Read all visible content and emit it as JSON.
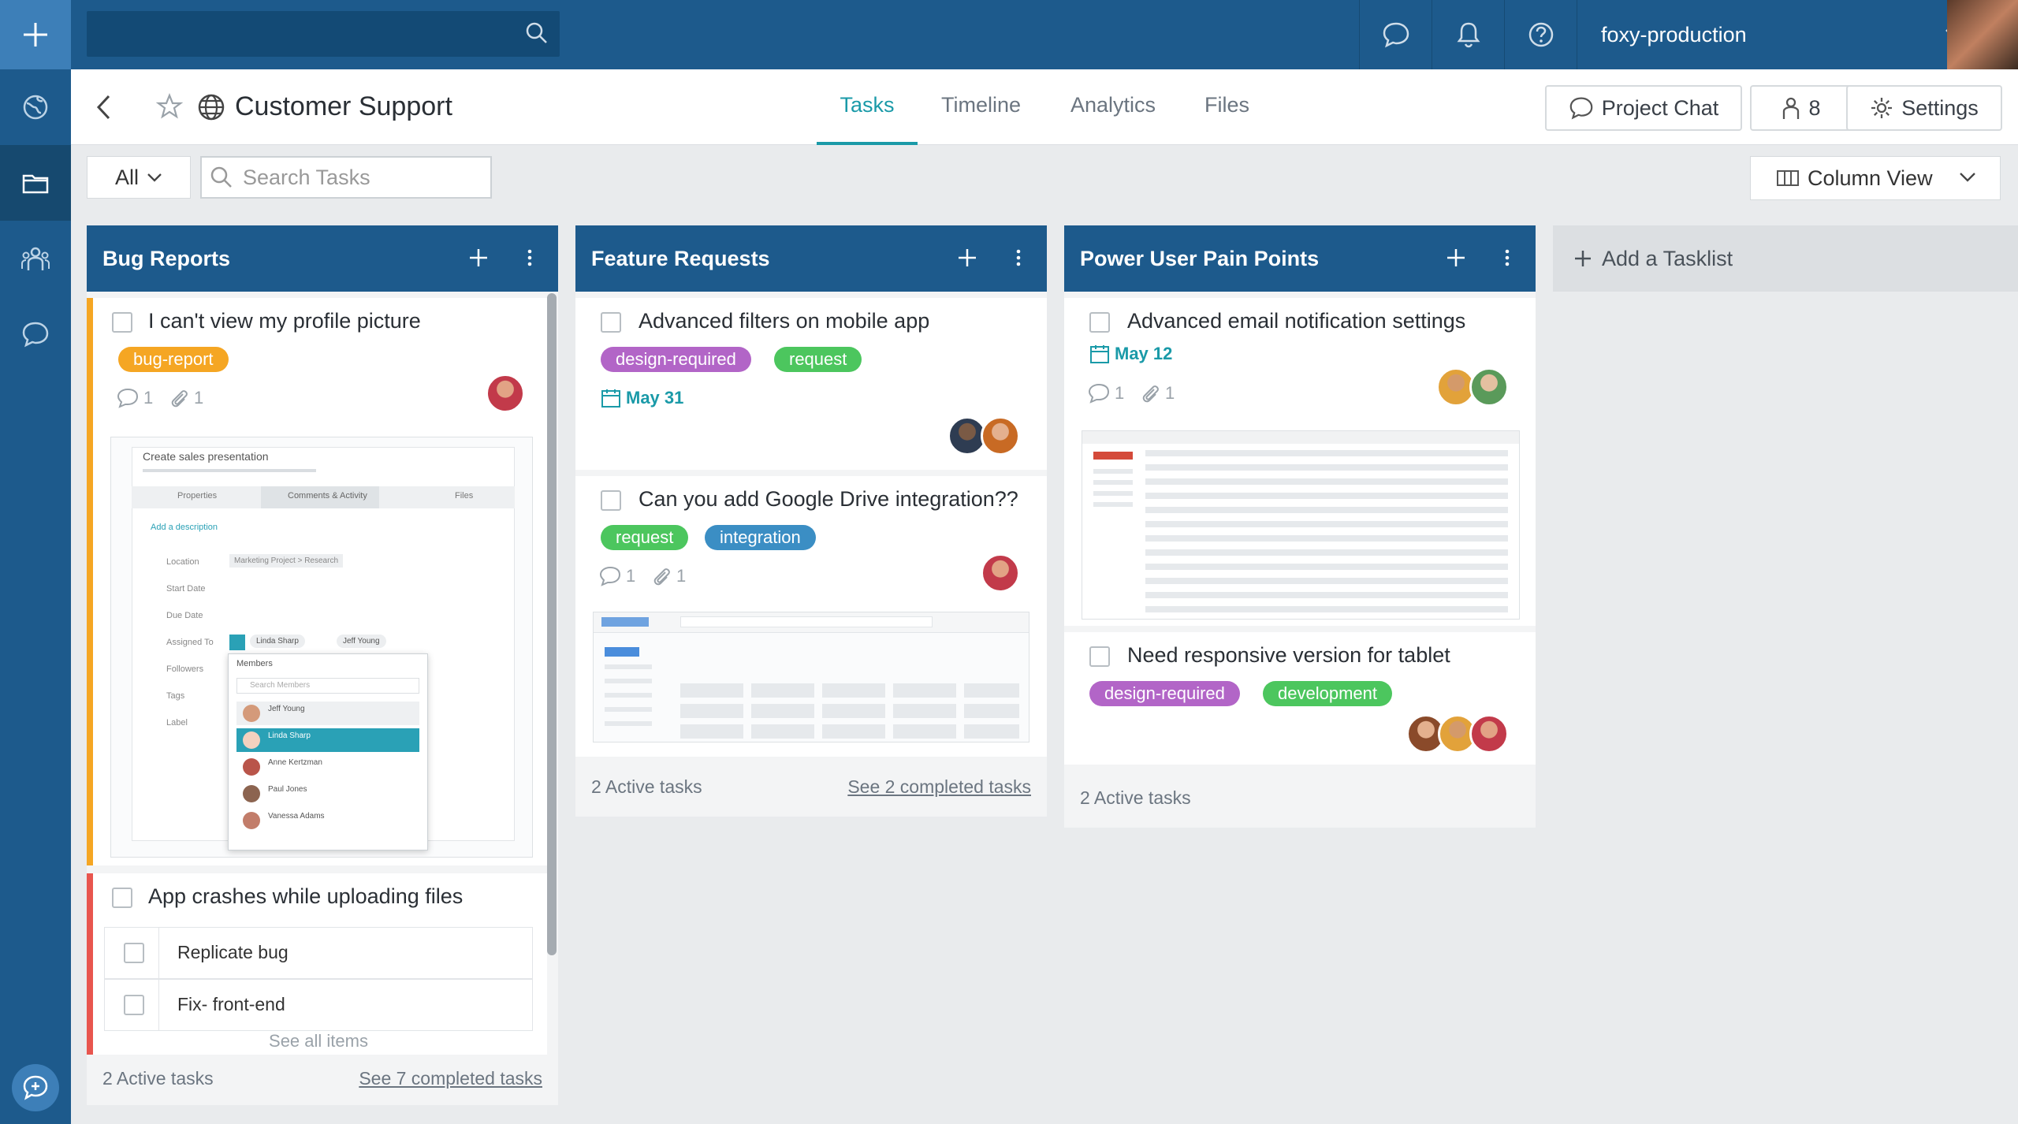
{
  "topbar": {
    "workspace": "foxy-production"
  },
  "project": {
    "title": "Customer Support"
  },
  "tabs": [
    "Tasks",
    "Timeline",
    "Analytics",
    "Files"
  ],
  "header_buttons": {
    "chat": "Project Chat",
    "members": "8",
    "settings": "Settings"
  },
  "filter": {
    "all": "All",
    "search_placeholder": "Search Tasks",
    "view": "Column View"
  },
  "columns": [
    {
      "title": "Bug Reports",
      "tasks": [
        {
          "title": "I can't view my profile picture",
          "tags": [
            "bug-report"
          ],
          "comments": "1",
          "attachments": "1"
        },
        {
          "title": "App crashes while uploading files",
          "subtasks": [
            "Replicate bug",
            "Fix- front-end"
          ],
          "see_all": "See all items"
        }
      ],
      "footer": {
        "active": "2 Active tasks",
        "completed": "See 7 completed tasks"
      }
    },
    {
      "title": "Feature Requests",
      "tasks": [
        {
          "title": "Advanced filters on mobile app",
          "tags": [
            "design-required",
            "request"
          ],
          "due": "May 31"
        },
        {
          "title": "Can you add Google Drive integration??",
          "tags": [
            "request",
            "integration"
          ],
          "comments": "1",
          "attachments": "1"
        }
      ],
      "footer": {
        "active": "2 Active tasks",
        "completed": "See 2 completed tasks"
      }
    },
    {
      "title": "Power User Pain Points",
      "tasks": [
        {
          "title": "Advanced email notification settings",
          "due": "May 12",
          "comments": "1",
          "attachments": "1"
        },
        {
          "title": "Need responsive version for tablet",
          "tags": [
            "design-required",
            "development"
          ]
        }
      ],
      "footer": {
        "active": "2 Active tasks"
      }
    }
  ],
  "add_tasklist": "Add a Tasklist",
  "thumb_bug": {
    "title": "Create sales presentation",
    "tabs": [
      "Properties",
      "Comments & Activity",
      "Files"
    ],
    "add_description": "Add a description",
    "fields": [
      "Location",
      "Start Date",
      "Due Date",
      "Assigned To",
      "Followers",
      "Tags",
      "Label"
    ],
    "location_value": "Marketing Project > Research",
    "assignees": [
      "Linda Sharp",
      "Jeff Young"
    ],
    "members_title": "Members",
    "members_search": "Search Members",
    "members": [
      "Jeff Young",
      "Linda Sharp",
      "Anne Kertzman",
      "Paul Jones",
      "Vanessa Adams"
    ]
  },
  "colors": {
    "primary": "#1d5a8c",
    "accent": "#1a9aa8",
    "bug_bar": "#f5a623",
    "crash_bar": "#e8554e"
  }
}
